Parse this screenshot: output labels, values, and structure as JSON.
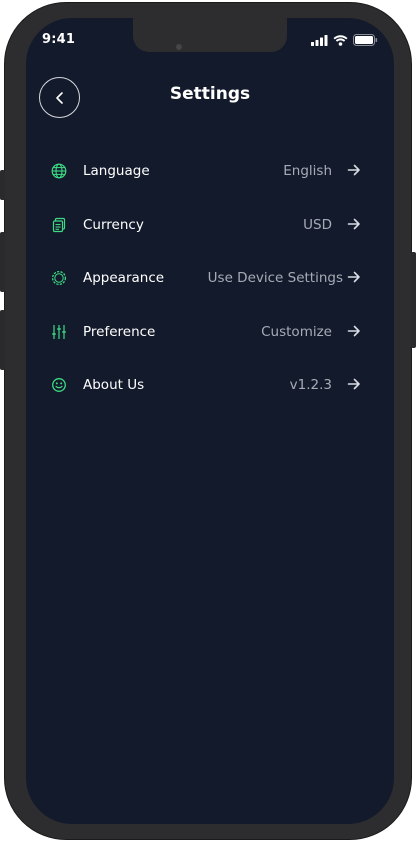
{
  "status_bar": {
    "time": "9:41"
  },
  "header": {
    "title": "Settings"
  },
  "colors": {
    "background": "#131a2b",
    "accent_icon": "#3ddc84",
    "value_text": "#a6abb6"
  },
  "settings": [
    {
      "icon": "globe-icon",
      "label": "Language",
      "value": "English"
    },
    {
      "icon": "currency-icon",
      "label": "Currency",
      "value": "USD"
    },
    {
      "icon": "appearance-icon",
      "label": "Appearance",
      "value": "Use Device Settings"
    },
    {
      "icon": "sliders-icon",
      "label": "Preference",
      "value": "Customize"
    },
    {
      "icon": "smiley-icon",
      "label": "About Us",
      "value": "v1.2.3"
    }
  ]
}
